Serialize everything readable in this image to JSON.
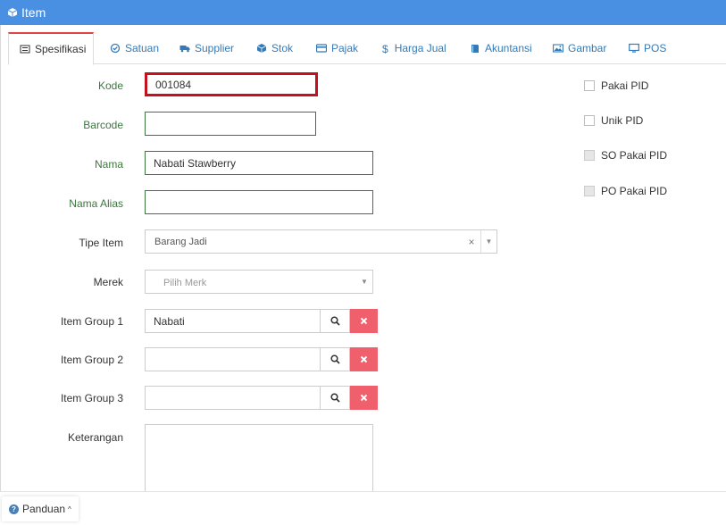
{
  "window": {
    "title": "Item",
    "icon": "cube-icon"
  },
  "tabs": [
    {
      "label": "Spesifikasi",
      "icon": "list-icon",
      "active": true
    },
    {
      "label": "Satuan",
      "icon": "check-circle-icon",
      "active": false
    },
    {
      "label": "Supplier",
      "icon": "truck-icon",
      "active": false
    },
    {
      "label": "Stok",
      "icon": "cube-icon",
      "active": false
    },
    {
      "label": "Pajak",
      "icon": "card-icon",
      "active": false
    },
    {
      "label": "Harga Jual",
      "icon": "dollar-icon",
      "active": false
    },
    {
      "label": "Akuntansi",
      "icon": "book-icon",
      "active": false
    },
    {
      "label": "Gambar",
      "icon": "image-icon",
      "active": false
    },
    {
      "label": "POS",
      "icon": "monitor-icon",
      "active": false
    }
  ],
  "form": {
    "kode": {
      "label": "Kode",
      "value": "001084"
    },
    "barcode": {
      "label": "Barcode",
      "value": ""
    },
    "nama": {
      "label": "Nama",
      "value": "Nabati Stawberry"
    },
    "nama_alias": {
      "label": "Nama Alias",
      "value": ""
    },
    "tipe_item": {
      "label": "Tipe Item",
      "value": "Barang Jadi",
      "clear": "×",
      "caret": "▼"
    },
    "merek": {
      "label": "Merek",
      "placeholder": "Pilih Merk",
      "caret": "▼"
    },
    "item_group_1": {
      "label": "Item Group 1",
      "value": "Nabati"
    },
    "item_group_2": {
      "label": "Item Group 2",
      "value": ""
    },
    "item_group_3": {
      "label": "Item Group 3",
      "value": ""
    },
    "keterangan": {
      "label": "Keterangan",
      "value": ""
    }
  },
  "checkboxes": [
    {
      "label": "Pakai PID",
      "checked": false,
      "disabled": false
    },
    {
      "label": "Unik PID",
      "checked": false,
      "disabled": false
    },
    {
      "label": "SO Pakai PID",
      "checked": false,
      "disabled": true
    },
    {
      "label": "PO Pakai PID",
      "checked": false,
      "disabled": true
    }
  ],
  "footer": {
    "panduan_label": "Panduan",
    "help_glyph": "?",
    "chevron": "^"
  },
  "colors": {
    "titlebar": "#4a90e2",
    "link": "#337ab7",
    "valid_border": "#3c763d",
    "error_border": "#c1121f",
    "delete_button": "#f0606c"
  }
}
